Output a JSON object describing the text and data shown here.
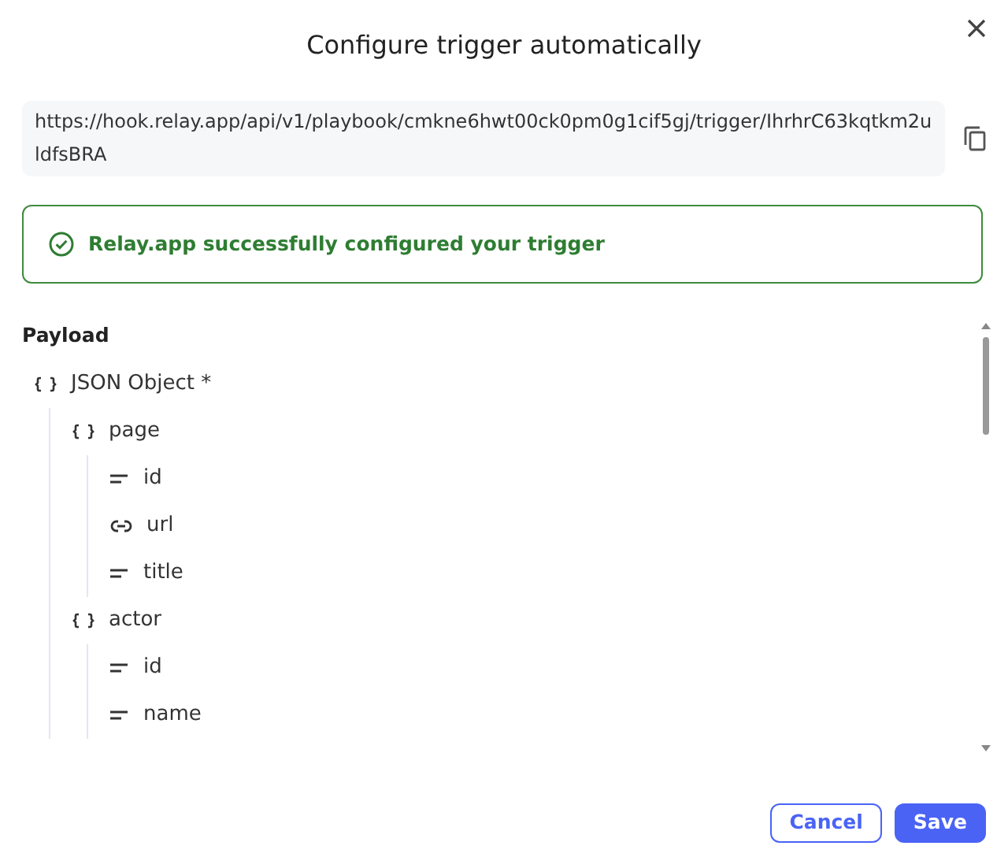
{
  "dialog": {
    "title": "Configure trigger automatically"
  },
  "webhook_url": "https://hook.relay.app/api/v1/playbook/cmkne6hwt00ck0pm0g1cif5gj/trigger/IhrhrC63kqtkm2uldfsBRA",
  "alert": {
    "kind": "success",
    "message": "Relay.app successfully configured your trigger"
  },
  "payload": {
    "label": "Payload",
    "tree": [
      {
        "kind": "object",
        "label": "JSON Object *",
        "children": [
          {
            "kind": "object",
            "label": "page",
            "children": [
              {
                "kind": "text",
                "label": "id"
              },
              {
                "kind": "link",
                "label": "url"
              },
              {
                "kind": "text",
                "label": "title"
              }
            ]
          },
          {
            "kind": "object",
            "label": "actor",
            "children": [
              {
                "kind": "text",
                "label": "id"
              },
              {
                "kind": "text",
                "label": "name"
              }
            ]
          }
        ]
      }
    ]
  },
  "buttons": [
    {
      "kind": "secondary",
      "label": "Cancel"
    },
    {
      "kind": "primary",
      "label": "Save"
    }
  ]
}
